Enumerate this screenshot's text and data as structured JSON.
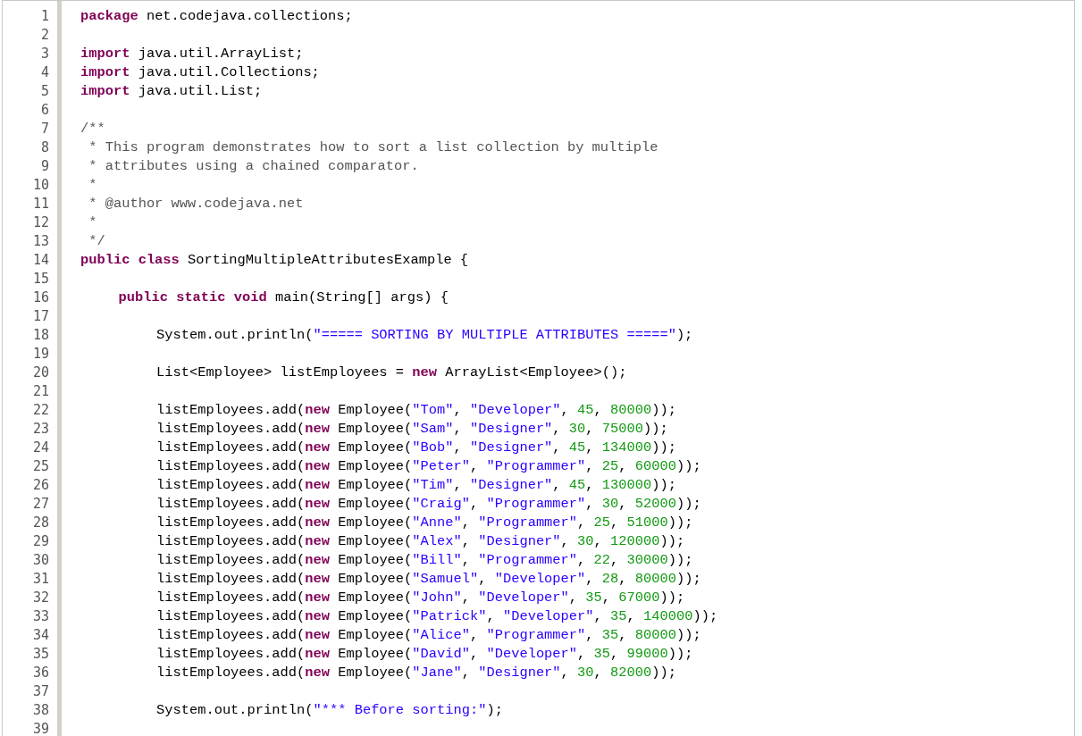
{
  "code_listing": {
    "lines": [
      {
        "number": "1",
        "tokens": [
          {
            "kind": "keyword",
            "text": "package"
          },
          {
            "kind": "plain",
            "text": " net.codejava.collections;"
          }
        ]
      },
      {
        "number": "2"
      },
      {
        "number": "3",
        "tokens": [
          {
            "kind": "keyword",
            "text": "import"
          },
          {
            "kind": "plain",
            "text": " java.util.ArrayList;"
          }
        ]
      },
      {
        "number": "4",
        "tokens": [
          {
            "kind": "keyword",
            "text": "import"
          },
          {
            "kind": "plain",
            "text": " java.util.Collections;"
          }
        ]
      },
      {
        "number": "5",
        "tokens": [
          {
            "kind": "keyword",
            "text": "import"
          },
          {
            "kind": "plain",
            "text": " java.util.List;"
          }
        ]
      },
      {
        "number": "6"
      },
      {
        "number": "7",
        "tokens": [
          {
            "kind": "comment",
            "text": "/**"
          }
        ]
      },
      {
        "number": "8",
        "tokens": [
          {
            "kind": "comment",
            "text": " * This program demonstrates how to sort a list collection by multiple"
          }
        ]
      },
      {
        "number": "9",
        "tokens": [
          {
            "kind": "comment",
            "text": " * attributes using a chained comparator."
          }
        ]
      },
      {
        "number": "10",
        "tokens": [
          {
            "kind": "comment",
            "text": " *"
          }
        ]
      },
      {
        "number": "11",
        "tokens": [
          {
            "kind": "comment",
            "text": " * @author www.codejava.net"
          }
        ]
      },
      {
        "number": "12",
        "tokens": [
          {
            "kind": "comment",
            "text": " *"
          }
        ]
      },
      {
        "number": "13",
        "tokens": [
          {
            "kind": "comment",
            "text": " */"
          }
        ]
      },
      {
        "number": "14",
        "tokens": [
          {
            "kind": "keyword",
            "text": "public class"
          },
          {
            "kind": "plain",
            "text": " SortingMultipleAttributesExample {"
          }
        ],
        "children": [
          {
            "number": "15"
          },
          {
            "number": "16",
            "tokens": [
              {
                "kind": "keyword",
                "text": "public static void"
              },
              {
                "kind": "plain",
                "text": " main(String[] args) {"
              }
            ],
            "children": [
              {
                "number": "17"
              },
              {
                "number": "18",
                "tokens": [
                  {
                    "kind": "plain",
                    "text": "System.out.println("
                  },
                  {
                    "kind": "string",
                    "text": "\"===== SORTING BY MULTIPLE ATTRIBUTES =====\""
                  },
                  {
                    "kind": "plain",
                    "text": ");"
                  }
                ]
              },
              {
                "number": "19"
              },
              {
                "number": "20",
                "tokens": [
                  {
                    "kind": "plain",
                    "text": "List<Employee> listEmployees = "
                  },
                  {
                    "kind": "keyword",
                    "text": "new"
                  },
                  {
                    "kind": "plain",
                    "text": " ArrayList<Employee>();"
                  }
                ]
              },
              {
                "number": "21"
              },
              {
                "number": "22",
                "tokens": [
                  {
                    "kind": "plain",
                    "text": "listEmployees.add("
                  },
                  {
                    "kind": "keyword",
                    "text": "new"
                  },
                  {
                    "kind": "plain",
                    "text": " Employee("
                  },
                  {
                    "kind": "string",
                    "text": "\"Tom\""
                  },
                  {
                    "kind": "plain",
                    "text": ", "
                  },
                  {
                    "kind": "string",
                    "text": "\"Developer\""
                  },
                  {
                    "kind": "plain",
                    "text": ", "
                  },
                  {
                    "kind": "number",
                    "text": "45"
                  },
                  {
                    "kind": "plain",
                    "text": ", "
                  },
                  {
                    "kind": "number",
                    "text": "80000"
                  },
                  {
                    "kind": "plain",
                    "text": "));"
                  }
                ]
              },
              {
                "number": "23",
                "tokens": [
                  {
                    "kind": "plain",
                    "text": "listEmployees.add("
                  },
                  {
                    "kind": "keyword",
                    "text": "new"
                  },
                  {
                    "kind": "plain",
                    "text": " Employee("
                  },
                  {
                    "kind": "string",
                    "text": "\"Sam\""
                  },
                  {
                    "kind": "plain",
                    "text": ", "
                  },
                  {
                    "kind": "string",
                    "text": "\"Designer\""
                  },
                  {
                    "kind": "plain",
                    "text": ", "
                  },
                  {
                    "kind": "number",
                    "text": "30"
                  },
                  {
                    "kind": "plain",
                    "text": ", "
                  },
                  {
                    "kind": "number",
                    "text": "75000"
                  },
                  {
                    "kind": "plain",
                    "text": "));"
                  }
                ]
              },
              {
                "number": "24",
                "tokens": [
                  {
                    "kind": "plain",
                    "text": "listEmployees.add("
                  },
                  {
                    "kind": "keyword",
                    "text": "new"
                  },
                  {
                    "kind": "plain",
                    "text": " Employee("
                  },
                  {
                    "kind": "string",
                    "text": "\"Bob\""
                  },
                  {
                    "kind": "plain",
                    "text": ", "
                  },
                  {
                    "kind": "string",
                    "text": "\"Designer\""
                  },
                  {
                    "kind": "plain",
                    "text": ", "
                  },
                  {
                    "kind": "number",
                    "text": "45"
                  },
                  {
                    "kind": "plain",
                    "text": ", "
                  },
                  {
                    "kind": "number",
                    "text": "134000"
                  },
                  {
                    "kind": "plain",
                    "text": "));"
                  }
                ]
              },
              {
                "number": "25",
                "tokens": [
                  {
                    "kind": "plain",
                    "text": "listEmployees.add("
                  },
                  {
                    "kind": "keyword",
                    "text": "new"
                  },
                  {
                    "kind": "plain",
                    "text": " Employee("
                  },
                  {
                    "kind": "string",
                    "text": "\"Peter\""
                  },
                  {
                    "kind": "plain",
                    "text": ", "
                  },
                  {
                    "kind": "string",
                    "text": "\"Programmer\""
                  },
                  {
                    "kind": "plain",
                    "text": ", "
                  },
                  {
                    "kind": "number",
                    "text": "25"
                  },
                  {
                    "kind": "plain",
                    "text": ", "
                  },
                  {
                    "kind": "number",
                    "text": "60000"
                  },
                  {
                    "kind": "plain",
                    "text": "));"
                  }
                ]
              },
              {
                "number": "26",
                "tokens": [
                  {
                    "kind": "plain",
                    "text": "listEmployees.add("
                  },
                  {
                    "kind": "keyword",
                    "text": "new"
                  },
                  {
                    "kind": "plain",
                    "text": " Employee("
                  },
                  {
                    "kind": "string",
                    "text": "\"Tim\""
                  },
                  {
                    "kind": "plain",
                    "text": ", "
                  },
                  {
                    "kind": "string",
                    "text": "\"Designer\""
                  },
                  {
                    "kind": "plain",
                    "text": ", "
                  },
                  {
                    "kind": "number",
                    "text": "45"
                  },
                  {
                    "kind": "plain",
                    "text": ", "
                  },
                  {
                    "kind": "number",
                    "text": "130000"
                  },
                  {
                    "kind": "plain",
                    "text": "));"
                  }
                ]
              },
              {
                "number": "27",
                "tokens": [
                  {
                    "kind": "plain",
                    "text": "listEmployees.add("
                  },
                  {
                    "kind": "keyword",
                    "text": "new"
                  },
                  {
                    "kind": "plain",
                    "text": " Employee("
                  },
                  {
                    "kind": "string",
                    "text": "\"Craig\""
                  },
                  {
                    "kind": "plain",
                    "text": ", "
                  },
                  {
                    "kind": "string",
                    "text": "\"Programmer\""
                  },
                  {
                    "kind": "plain",
                    "text": ", "
                  },
                  {
                    "kind": "number",
                    "text": "30"
                  },
                  {
                    "kind": "plain",
                    "text": ", "
                  },
                  {
                    "kind": "number",
                    "text": "52000"
                  },
                  {
                    "kind": "plain",
                    "text": "));"
                  }
                ]
              },
              {
                "number": "28",
                "tokens": [
                  {
                    "kind": "plain",
                    "text": "listEmployees.add("
                  },
                  {
                    "kind": "keyword",
                    "text": "new"
                  },
                  {
                    "kind": "plain",
                    "text": " Employee("
                  },
                  {
                    "kind": "string",
                    "text": "\"Anne\""
                  },
                  {
                    "kind": "plain",
                    "text": ", "
                  },
                  {
                    "kind": "string",
                    "text": "\"Programmer\""
                  },
                  {
                    "kind": "plain",
                    "text": ", "
                  },
                  {
                    "kind": "number",
                    "text": "25"
                  },
                  {
                    "kind": "plain",
                    "text": ", "
                  },
                  {
                    "kind": "number",
                    "text": "51000"
                  },
                  {
                    "kind": "plain",
                    "text": "));"
                  }
                ]
              },
              {
                "number": "29",
                "tokens": [
                  {
                    "kind": "plain",
                    "text": "listEmployees.add("
                  },
                  {
                    "kind": "keyword",
                    "text": "new"
                  },
                  {
                    "kind": "plain",
                    "text": " Employee("
                  },
                  {
                    "kind": "string",
                    "text": "\"Alex\""
                  },
                  {
                    "kind": "plain",
                    "text": ", "
                  },
                  {
                    "kind": "string",
                    "text": "\"Designer\""
                  },
                  {
                    "kind": "plain",
                    "text": ", "
                  },
                  {
                    "kind": "number",
                    "text": "30"
                  },
                  {
                    "kind": "plain",
                    "text": ", "
                  },
                  {
                    "kind": "number",
                    "text": "120000"
                  },
                  {
                    "kind": "plain",
                    "text": "));"
                  }
                ]
              },
              {
                "number": "30",
                "tokens": [
                  {
                    "kind": "plain",
                    "text": "listEmployees.add("
                  },
                  {
                    "kind": "keyword",
                    "text": "new"
                  },
                  {
                    "kind": "plain",
                    "text": " Employee("
                  },
                  {
                    "kind": "string",
                    "text": "\"Bill\""
                  },
                  {
                    "kind": "plain",
                    "text": ", "
                  },
                  {
                    "kind": "string",
                    "text": "\"Programmer\""
                  },
                  {
                    "kind": "plain",
                    "text": ", "
                  },
                  {
                    "kind": "number",
                    "text": "22"
                  },
                  {
                    "kind": "plain",
                    "text": ", "
                  },
                  {
                    "kind": "number",
                    "text": "30000"
                  },
                  {
                    "kind": "plain",
                    "text": "));"
                  }
                ]
              },
              {
                "number": "31",
                "tokens": [
                  {
                    "kind": "plain",
                    "text": "listEmployees.add("
                  },
                  {
                    "kind": "keyword",
                    "text": "new"
                  },
                  {
                    "kind": "plain",
                    "text": " Employee("
                  },
                  {
                    "kind": "string",
                    "text": "\"Samuel\""
                  },
                  {
                    "kind": "plain",
                    "text": ", "
                  },
                  {
                    "kind": "string",
                    "text": "\"Developer\""
                  },
                  {
                    "kind": "plain",
                    "text": ", "
                  },
                  {
                    "kind": "number",
                    "text": "28"
                  },
                  {
                    "kind": "plain",
                    "text": ", "
                  },
                  {
                    "kind": "number",
                    "text": "80000"
                  },
                  {
                    "kind": "plain",
                    "text": "));"
                  }
                ]
              },
              {
                "number": "32",
                "tokens": [
                  {
                    "kind": "plain",
                    "text": "listEmployees.add("
                  },
                  {
                    "kind": "keyword",
                    "text": "new"
                  },
                  {
                    "kind": "plain",
                    "text": " Employee("
                  },
                  {
                    "kind": "string",
                    "text": "\"John\""
                  },
                  {
                    "kind": "plain",
                    "text": ", "
                  },
                  {
                    "kind": "string",
                    "text": "\"Developer\""
                  },
                  {
                    "kind": "plain",
                    "text": ", "
                  },
                  {
                    "kind": "number",
                    "text": "35"
                  },
                  {
                    "kind": "plain",
                    "text": ", "
                  },
                  {
                    "kind": "number",
                    "text": "67000"
                  },
                  {
                    "kind": "plain",
                    "text": "));"
                  }
                ]
              },
              {
                "number": "33",
                "tokens": [
                  {
                    "kind": "plain",
                    "text": "listEmployees.add("
                  },
                  {
                    "kind": "keyword",
                    "text": "new"
                  },
                  {
                    "kind": "plain",
                    "text": " Employee("
                  },
                  {
                    "kind": "string",
                    "text": "\"Patrick\""
                  },
                  {
                    "kind": "plain",
                    "text": ", "
                  },
                  {
                    "kind": "string",
                    "text": "\"Developer\""
                  },
                  {
                    "kind": "plain",
                    "text": ", "
                  },
                  {
                    "kind": "number",
                    "text": "35"
                  },
                  {
                    "kind": "plain",
                    "text": ", "
                  },
                  {
                    "kind": "number",
                    "text": "140000"
                  },
                  {
                    "kind": "plain",
                    "text": "));"
                  }
                ]
              },
              {
                "number": "34",
                "tokens": [
                  {
                    "kind": "plain",
                    "text": "listEmployees.add("
                  },
                  {
                    "kind": "keyword",
                    "text": "new"
                  },
                  {
                    "kind": "plain",
                    "text": " Employee("
                  },
                  {
                    "kind": "string",
                    "text": "\"Alice\""
                  },
                  {
                    "kind": "plain",
                    "text": ", "
                  },
                  {
                    "kind": "string",
                    "text": "\"Programmer\""
                  },
                  {
                    "kind": "plain",
                    "text": ", "
                  },
                  {
                    "kind": "number",
                    "text": "35"
                  },
                  {
                    "kind": "plain",
                    "text": ", "
                  },
                  {
                    "kind": "number",
                    "text": "80000"
                  },
                  {
                    "kind": "plain",
                    "text": "));"
                  }
                ]
              },
              {
                "number": "35",
                "tokens": [
                  {
                    "kind": "plain",
                    "text": "listEmployees.add("
                  },
                  {
                    "kind": "keyword",
                    "text": "new"
                  },
                  {
                    "kind": "plain",
                    "text": " Employee("
                  },
                  {
                    "kind": "string",
                    "text": "\"David\""
                  },
                  {
                    "kind": "plain",
                    "text": ", "
                  },
                  {
                    "kind": "string",
                    "text": "\"Developer\""
                  },
                  {
                    "kind": "plain",
                    "text": ", "
                  },
                  {
                    "kind": "number",
                    "text": "35"
                  },
                  {
                    "kind": "plain",
                    "text": ", "
                  },
                  {
                    "kind": "number",
                    "text": "99000"
                  },
                  {
                    "kind": "plain",
                    "text": "));"
                  }
                ]
              },
              {
                "number": "36",
                "tokens": [
                  {
                    "kind": "plain",
                    "text": "listEmployees.add("
                  },
                  {
                    "kind": "keyword",
                    "text": "new"
                  },
                  {
                    "kind": "plain",
                    "text": " Employee("
                  },
                  {
                    "kind": "string",
                    "text": "\"Jane\""
                  },
                  {
                    "kind": "plain",
                    "text": ", "
                  },
                  {
                    "kind": "string",
                    "text": "\"Designer\""
                  },
                  {
                    "kind": "plain",
                    "text": ", "
                  },
                  {
                    "kind": "number",
                    "text": "30"
                  },
                  {
                    "kind": "plain",
                    "text": ", "
                  },
                  {
                    "kind": "number",
                    "text": "82000"
                  },
                  {
                    "kind": "plain",
                    "text": "));"
                  }
                ]
              },
              {
                "number": "37"
              },
              {
                "number": "38",
                "tokens": [
                  {
                    "kind": "plain",
                    "text": "System.out.println("
                  },
                  {
                    "kind": "string",
                    "text": "\"*** Before sorting:\""
                  },
                  {
                    "kind": "plain",
                    "text": ");"
                  }
                ]
              },
              {
                "number": "39"
              }
            ]
          }
        ]
      }
    ]
  }
}
